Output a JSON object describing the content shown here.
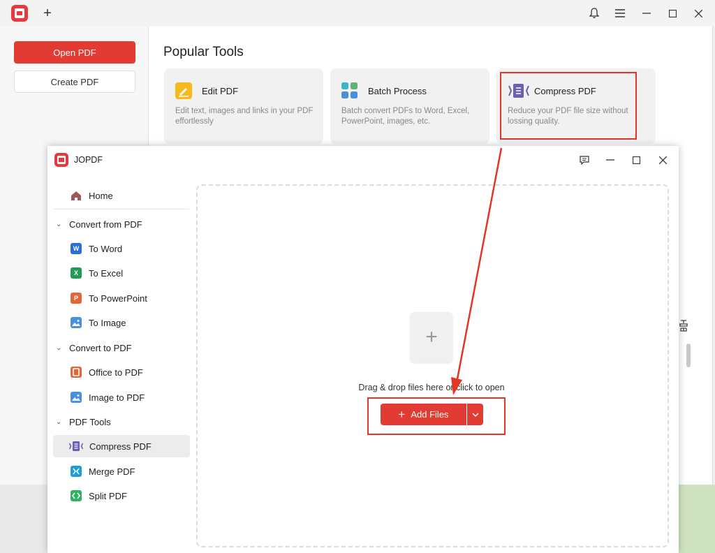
{
  "background_window": {
    "buttons": {
      "open_pdf": "Open PDF",
      "create_pdf": "Create PDF"
    },
    "section_title": "Popular Tools",
    "tools": [
      {
        "name": "Edit PDF",
        "desc": "Edit text, images and links in your PDF effortlessly"
      },
      {
        "name": "Batch Process",
        "desc": "Batch convert PDFs to Word, Excel, PowerPoint, images, etc."
      },
      {
        "name": "Compress PDF",
        "desc": "Reduce your PDF file size without lossing quality."
      }
    ]
  },
  "window": {
    "title": "JOPDF",
    "sidebar": {
      "home": "Home",
      "groups": [
        {
          "label": "Convert from PDF",
          "items": [
            "To Word",
            "To Excel",
            "To PowerPoint",
            "To Image"
          ]
        },
        {
          "label": "Convert to PDF",
          "items": [
            "Office to PDF",
            "Image to PDF"
          ]
        },
        {
          "label": "PDF Tools",
          "items": [
            "Compress PDF",
            "Merge PDF",
            "Split PDF"
          ]
        }
      ],
      "active_item": "Compress PDF"
    },
    "drop_zone": {
      "text": "Drag & drop files here or click to open",
      "add_button": "Add Files"
    }
  },
  "colors": {
    "accent": "#e23b33",
    "highlight": "#e53524"
  }
}
